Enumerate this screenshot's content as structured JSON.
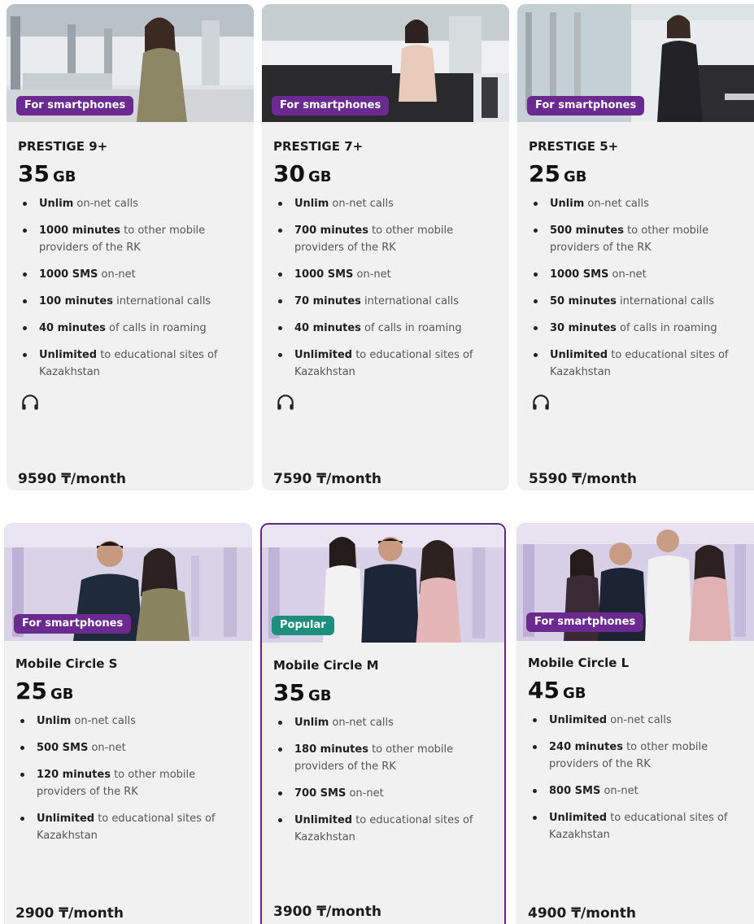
{
  "colors": {
    "brand_purple": "#6b2a8f",
    "popular_green": "#1e8f7c",
    "card_bg": "#f1f1f1"
  },
  "icons": {
    "headphones": "headphones-icon"
  },
  "cards": [
    {
      "badge": "For smartphones",
      "name": "PRESTIGE 9+",
      "gb": "35",
      "gb_unit": "GB",
      "features": [
        {
          "bold": "Unlim",
          "text": " on-net calls"
        },
        {
          "bold": "1000 minutes",
          "text": " to other mobile providers of the RK"
        },
        {
          "bold": "1000 SMS",
          "text": " on-net"
        },
        {
          "bold": "100 minutes",
          "text": " international calls"
        },
        {
          "bold": "40 minutes",
          "text": " of calls in roaming"
        },
        {
          "bold": "Unlimited",
          "text": " to educational sites of Kazakhstan"
        }
      ],
      "price": "9590 ₸/month"
    },
    {
      "badge": "For smartphones",
      "name": "PRESTIGE 7+",
      "gb": "30",
      "gb_unit": "GB",
      "features": [
        {
          "bold": "Unlim",
          "text": " on-net calls"
        },
        {
          "bold": "700 minutes",
          "text": " to other mobile providers of the RK"
        },
        {
          "bold": "1000 SMS",
          "text": " on-net"
        },
        {
          "bold": "70 minutes",
          "text": " international calls"
        },
        {
          "bold": "40 minutes",
          "text": " of calls in roaming"
        },
        {
          "bold": "Unlimited",
          "text": " to educational sites of Kazakhstan"
        }
      ],
      "price": "7590 ₸/month"
    },
    {
      "badge": "For smartphones",
      "name": "PRESTIGE 5+",
      "gb": "25",
      "gb_unit": "GB",
      "features": [
        {
          "bold": "Unlim",
          "text": " on-net calls"
        },
        {
          "bold": "500 minutes",
          "text": " to other mobile providers of the RK"
        },
        {
          "bold": "1000 SMS",
          "text": " on-net"
        },
        {
          "bold": "50 minutes",
          "text": " international calls"
        },
        {
          "bold": "30 minutes",
          "text": " of calls in roaming"
        },
        {
          "bold": "Unlimited",
          "text": " to educational sites of Kazakhstan"
        }
      ],
      "price": "5590 ₸/month"
    },
    {
      "badge": "For smartphones",
      "name": "Mobile Circle S",
      "gb": "25",
      "gb_unit": "GB",
      "features": [
        {
          "bold": "Unlim",
          "text": " on-net calls"
        },
        {
          "bold": "500 SMS",
          "text": " on-net"
        },
        {
          "bold": "120 minutes",
          "text": " to other mobile providers of the RK"
        },
        {
          "bold": "Unlimited",
          "text": " to educational sites of Kazakhstan"
        }
      ],
      "price": "2900 ₸/month"
    },
    {
      "badge": "Popular",
      "name": "Mobile Circle M",
      "gb": "35",
      "gb_unit": "GB",
      "features": [
        {
          "bold": "Unlim",
          "text": " on-net calls"
        },
        {
          "bold": "180 minutes",
          "text": " to other mobile providers of the RK"
        },
        {
          "bold": "700 SMS",
          "text": " on-net"
        },
        {
          "bold": "Unlimited",
          "text": " to educational sites of Kazakhstan"
        }
      ],
      "price": "3900 ₸/month"
    },
    {
      "badge": "For smartphones",
      "name": "Mobile Circle L",
      "gb": "45",
      "gb_unit": "GB",
      "features": [
        {
          "bold": "Unlimited",
          "text": " on-net calls"
        },
        {
          "bold": "240 minutes",
          "text": " to other mobile providers of the RK"
        },
        {
          "bold": "800 SMS",
          "text": " on-net"
        },
        {
          "bold": "Unlimited",
          "text": " to educational sites of Kazakhstan"
        }
      ],
      "price": "4900 ₸/month"
    }
  ]
}
